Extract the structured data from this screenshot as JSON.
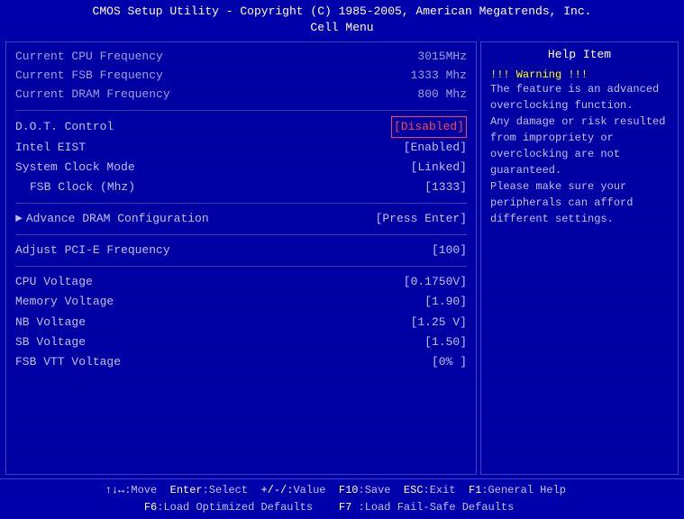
{
  "title": {
    "line1": "CMOS Setup Utility - Copyright (C) 1985-2005, American Megatrends, Inc.",
    "line2": "Cell Menu"
  },
  "info_items": [
    {
      "label": "Current CPU Frequency",
      "value": "3015MHz"
    },
    {
      "label": "Current FSB Frequency",
      "value": "1333 Mhz"
    },
    {
      "label": "Current DRAM Frequency",
      "value": "800 Mhz"
    }
  ],
  "settings": [
    {
      "label": "D.O.T. Control",
      "value": "[Disabled]",
      "selected": true
    },
    {
      "label": "Intel EIST",
      "value": "[Enabled]",
      "selected": false
    },
    {
      "label": "System Clock Mode",
      "value": "[Linked]",
      "selected": false
    },
    {
      "label": "FSB Clock (Mhz)",
      "value": "[1333]",
      "selected": false,
      "indent": true
    }
  ],
  "submenu": {
    "label": "Advance DRAM Configuration",
    "value": "[Press Enter]"
  },
  "pcie": {
    "label": "Adjust PCI-E Frequency",
    "value": "[100]"
  },
  "voltages": [
    {
      "label": "CPU Voltage",
      "value": "[0.1750V]"
    },
    {
      "label": "Memory Voltage",
      "value": "[1.90]"
    },
    {
      "label": "NB Voltage",
      "value": "[1.25 V]"
    },
    {
      "label": "SB Voltage",
      "value": "[1.50]"
    },
    {
      "label": "FSB VTT Voltage",
      "value": "[0%  ]"
    }
  ],
  "help": {
    "title": "Help Item",
    "warning": "!!! Warning !!!",
    "text": "The feature is an advanced overclocking function.\nAny damage or risk resulted from impropriety or overclocking are not guaranteed.\nPlease make sure your peripherals can afford different settings."
  },
  "footer": {
    "line1_parts": [
      {
        "key": "↑↓↔",
        "desc": ":Move"
      },
      {
        "key": "Enter",
        "desc": ":Select"
      },
      {
        "key": "+/-/:",
        "desc": "Value"
      },
      {
        "key": "F10",
        "desc": ":Save"
      },
      {
        "key": "ESC",
        "desc": ":Exit"
      },
      {
        "key": "F1",
        "desc": ":General Help"
      }
    ],
    "line2_parts": [
      {
        "key": "F6",
        "desc": ":Load Optimized Defaults"
      },
      {
        "key": "F7",
        "desc": " :Load Fail-Safe Defaults"
      }
    ]
  }
}
